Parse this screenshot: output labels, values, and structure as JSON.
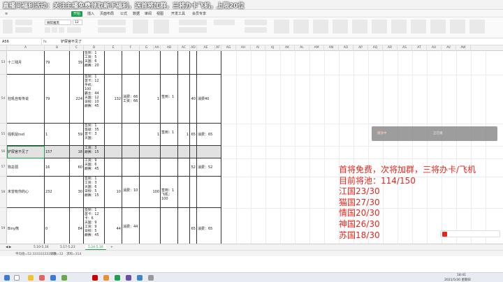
{
  "window": {
    "title_overlay": "直播间福利活动：关注主播免费领取新手福利，送首将加群，三将办卡飞机，上限20位"
  },
  "ribbon_tabs": [
    "开始",
    "插入",
    "页面布局",
    "公式",
    "数据",
    "审阅",
    "视图",
    "开发工具",
    "会员专享"
  ],
  "active_ribbon_tab": "开始",
  "font": {
    "name": "微软雅黑",
    "size": "12"
  },
  "formula_bar": {
    "name_box": "A56",
    "fx": "fx",
    "content": "铲屎官不见了"
  },
  "columns": [
    "A",
    "B",
    "C",
    "D",
    "E",
    "F",
    "G",
    "AA",
    "AB",
    "AC",
    "AD",
    "AE",
    "AF",
    "AG",
    "AH",
    "AI",
    "AJ",
    "AK",
    "AL",
    "AM",
    "AN",
    "AO",
    "AP",
    "AQ",
    "AR",
    "AS",
    "AT",
    "AU",
    "AV",
    "AW"
  ],
  "rows": [
    {
      "num": "53",
      "name": "十二残月",
      "b": "79",
      "c": "39",
      "d": "签到：1\n工资：5\n天国：6\n巅赛：20",
      "e": "",
      "f": "",
      "g": "",
      "h": "",
      "i": "",
      "j": "",
      "k": ""
    },
    {
      "num": "54",
      "name": "狂吼自有传说",
      "b": "79",
      "c": "224",
      "d": "签到：1\n首卡：12\n手机：\n100\n霸主：44\n天国：12\n日榜：10\n巅赛：45",
      "e": "132",
      "f": "消费：66\n工资：66",
      "g": "1",
      "h": "签到：1",
      "i": "",
      "j": "40",
      "k": "消费40"
    },
    {
      "num": "55",
      "name": "强帆鼠nsd",
      "b": "1",
      "c": "59",
      "d": "签到：1\n等级：35\n首卡：3\n天国：",
      "e": "",
      "f": "",
      "g": "1",
      "h": "签到：1",
      "i": "1",
      "j": "65",
      "k": "消费：65"
    },
    {
      "num": "56",
      "name": "铲屎官不见了",
      "b": "157",
      "c": "18",
      "d": "工资：3\n巅赛：15",
      "e": "",
      "f": "",
      "g": "",
      "h": "",
      "i": "",
      "j": "",
      "k": ""
    },
    {
      "num": "57",
      "name": "狗总弱",
      "b": "16",
      "c": "60",
      "d": "工资：9\n天国：6\n巅赛：45",
      "e": "",
      "f": "",
      "g": "",
      "h": "",
      "i": "",
      "j": "52",
      "k": "消费：52"
    },
    {
      "num": "58",
      "name": "未曾有你的心",
      "b": "232",
      "c": "30",
      "d": "签到：1\n工资：3\n天国：6\n日榜：5\n巅赛：15",
      "e": "10",
      "f": "消费：10",
      "g": "100",
      "h": "签到：1\n飞机：\n100",
      "i": "",
      "j": "",
      "k": ""
    },
    {
      "num": "59",
      "name": "Biny熊",
      "b": "0",
      "c": "84",
      "d": "签到：1\n首卡：12\n卡：6\n天国：9\n工资：9\n日榜：5\n巅赛：45",
      "e": "44",
      "f": "消费：44",
      "g": "",
      "h": "",
      "i": "",
      "j": "65",
      "k": "消费：65"
    }
  ],
  "sheet_tabs": [
    "5.10-5.16",
    "5.17-5.23",
    "5.24-5.30"
  ],
  "active_sheet": "5.24-5.30",
  "status": {
    "avg": "平均值=52.333333333333",
    "count": "计数=12",
    "sum": "求和=314"
  },
  "popup_dark": {
    "left_text": "播放中",
    "right_text": "正在播"
  },
  "overlay_notice": [
    "首将免费，次将加群，三将办卡/飞机",
    "目前将池：114/150",
    "江国23/30",
    "猫国27/30",
    "情国20/30",
    "神国26/30",
    "苏国18/30"
  ],
  "taskbar": {
    "time": "18:41",
    "date": "2021/5/30 星期日"
  },
  "colors": {
    "accent": "#1e9e4e",
    "overlay_red": "#e8261d",
    "selected_row": "#e2e2e2"
  }
}
